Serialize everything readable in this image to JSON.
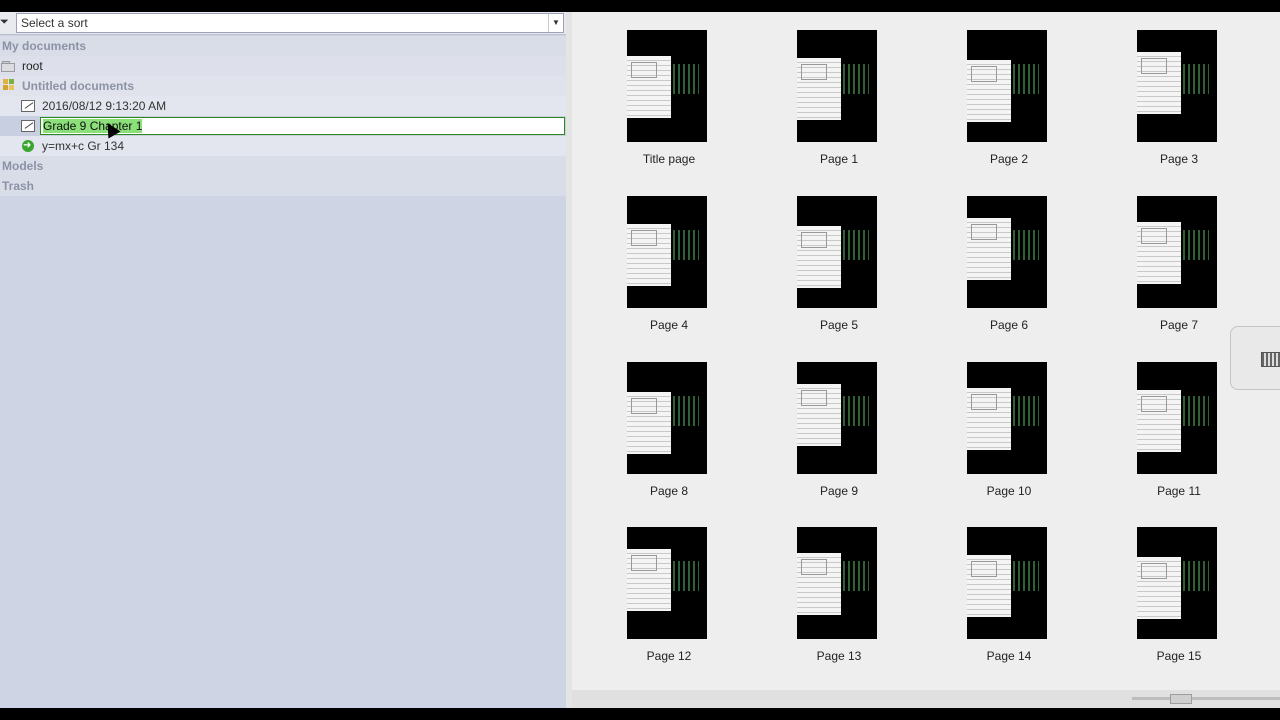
{
  "sort": {
    "placeholder": "Select a sort"
  },
  "tree": {
    "my_documents": "My documents",
    "root": "root",
    "untitled_documents": "Untitled documents",
    "doc_timestamp": "2016/08/12 9:13:20 AM",
    "rename_value": "Grade 9 Chapter 1",
    "link_item": "y=mx+c Gr 134",
    "models": "Models",
    "trash": "Trash"
  },
  "pages": [
    "Title page",
    "Page 1",
    "Page 2",
    "Page 3",
    "Page 4",
    "Page 5",
    "Page 6",
    "Page 7",
    "Page 8",
    "Page 9",
    "Page 10",
    "Page 11",
    "Page 12",
    "Page 13",
    "Page 14",
    "Page 15"
  ],
  "colors": {
    "selection_border": "#2c8a1d",
    "selection_fill": "#8be07a",
    "panel_bg": "#ced4e4"
  }
}
